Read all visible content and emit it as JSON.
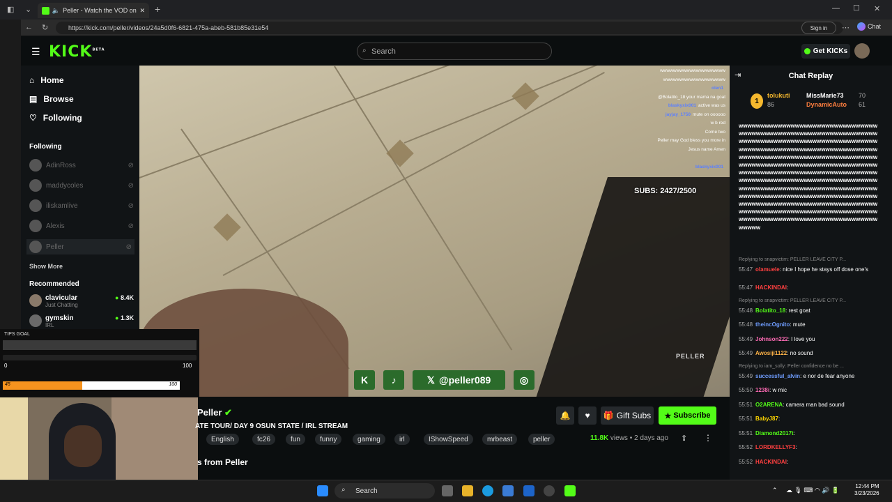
{
  "browser": {
    "tab_title": "Peller - Watch the VOD on Ki",
    "url": "https://kick.com/peller/videos/24a5d0f6-6821-475a-abeb-581b85e31e54",
    "signin": "Sign in",
    "chat_label": "Chat"
  },
  "header": {
    "logo": "KICK",
    "logo_sup": "BETA",
    "search_placeholder": "Search",
    "get_kicks": "Get KICKs"
  },
  "sidebar": {
    "nav": [
      {
        "label": "Home"
      },
      {
        "label": "Browse"
      },
      {
        "label": "Following"
      }
    ],
    "following_title": "Following",
    "following": [
      "AdinRoss",
      "maddycoles",
      "iliskamlive",
      "Alexis",
      "Peller"
    ],
    "show_more": "Show More",
    "recommended_title": "Recommended",
    "recommended": [
      {
        "name": "clavicular",
        "category": "Just Chatting",
        "viewers": "8.4K"
      },
      {
        "name": "gymskin",
        "category": "IRL",
        "viewers": "1.3K"
      }
    ]
  },
  "video": {
    "subs": "SUBS: 2427/2500",
    "watermark": "PELLER",
    "overlay_chat": [
      {
        "name": "",
        "text": "wwwwwwwwwwwwwwwwwwww"
      },
      {
        "name": "",
        "text": "wwwwwwwwwwwwwwwwwww"
      },
      {
        "name": "olen1",
        "text": ""
      },
      {
        "name": "",
        "text": "@Bolatito_18 your mama na goat"
      },
      {
        "name": "blaskyxix001",
        "text": "active was us"
      },
      {
        "name": "jayjay_1750",
        "text": "mute on oooooo"
      },
      {
        "name": "",
        "text": "w b red"
      },
      {
        "name": "",
        "text": "Come two"
      },
      {
        "name": "",
        "text": "Peller may God bless you more in"
      },
      {
        "name": "",
        "text": "Jesus name Amen"
      },
      {
        "name": "",
        "text": ""
      },
      {
        "name": "blaskyxix001",
        "text": ""
      }
    ],
    "social_handle": "@peller089"
  },
  "tips": {
    "label": "TIPS GOAL",
    "min": "0",
    "max": "100",
    "bar2_left": "45",
    "bar2_right": "100",
    "progress": 0.45
  },
  "channel": {
    "name": "Peller",
    "title": "ATE TOUR/ DAY 9 OSUN STATE / IRL STREAM",
    "tags": [
      "English",
      "fc26",
      "fun",
      "funny",
      "gaming",
      "irl",
      "IShowSpeed",
      "mrbeast",
      "peller"
    ],
    "views": "11.8K",
    "views_label": "views",
    "age": "2 days ago",
    "gift_subs": "Gift Subs",
    "subscribe": "Subscribe",
    "videos_heading": "s from Peller"
  },
  "chat": {
    "title": "Chat Replay",
    "gifters": [
      {
        "name": "tolukuti",
        "count": "86"
      },
      {
        "name": "MissMarie73",
        "count": "70"
      },
      {
        "name": "DynamicAuto",
        "count": "61"
      }
    ],
    "spam": "wwwwwwwwwwwwwwwwwwwwwwwwwwwwwwwwwwwwwwwwwwwwwwwwwwwwwwwwwwwwwwwwwwwwwwwwwwwwwwwwwwwwwwwwwwwwwwwwwwwwwwwwwwwwwwwwwwwwwwwwwwwwwwwwwwwwwwwwwwwwwwwwwwwwwwwwwwwwwwwwwwwwwwwwwwwwwwwwwwwwwwwwwwwwwwwwwwwwwwwwwwwwwwwwwwwwwwwwwwwwwwwwwwwwwwwwwwwwwwwwwwwwwwwwwwwwwwwwwwwwwwwwwwwwwwwwwwwwwwwwwwwwwwwwwwwwwwwwwwwwwwwwwwwwwwwwwwwwwwwwwwwwwwwwwwwwwwwwwwwwwwwwwwwwwwwwwwwwwwwwwwwwwwwwwwwwwwwwwwwwwwwwwwwwwwwwwwwwwwwwwwwwwwwwwwwwwwwwwwwww",
    "messages": [
      {
        "reply": "Replying to snapvictim: PELLER LEAVE CITY P...",
        "time": "",
        "user": "",
        "color": "",
        "text": ""
      },
      {
        "reply": "",
        "time": "55:47",
        "user": "olamuele",
        "color": "#ff4040",
        "text": "nice I hope he stays off dose one's"
      },
      {
        "reply": "",
        "time": "55:47",
        "user": "HACKINDAI",
        "color": "#ff4040",
        "text": ""
      },
      {
        "reply": "Replying to snapvictim: PELLER LEAVE CITY P...",
        "time": "",
        "user": "",
        "color": "",
        "text": ""
      },
      {
        "reply": "",
        "time": "55:48",
        "user": "Bolatito_18",
        "color": "#53fc18",
        "text": "rest goat"
      },
      {
        "reply": "",
        "time": "55:48",
        "user": "theincOgnito",
        "color": "#6f9dff",
        "text": "mute"
      },
      {
        "reply": "",
        "time": "55:49",
        "user": "Johnson222",
        "color": "#ff6bb5",
        "text": "I love you"
      },
      {
        "reply": "",
        "time": "55:49",
        "user": "Awosiji1122",
        "color": "#ffb347",
        "text": "no sound"
      },
      {
        "reply": "Replying to iam_solly: Peller confidence no be ...",
        "time": "",
        "user": "",
        "color": "",
        "text": ""
      },
      {
        "reply": "",
        "time": "55:49",
        "user": "successful_alvin",
        "color": "#6f9dff",
        "text": "e nor de fear anyone"
      },
      {
        "reply": "",
        "time": "55:50",
        "user": "1238i",
        "color": "#ff6bb5",
        "text": "w mic"
      },
      {
        "reply": "",
        "time": "55:51",
        "user": "O2ARENA",
        "color": "#53fc18",
        "text": "camera man bad sound"
      },
      {
        "reply": "",
        "time": "55:51",
        "user": "BabyJ87",
        "color": "#ffd700",
        "text": ""
      },
      {
        "reply": "",
        "time": "55:51",
        "user": "Diamond2017t",
        "color": "#53fc18",
        "text": ""
      },
      {
        "reply": "",
        "time": "55:52",
        "user": "LORDKELLYF3",
        "color": "#ff4040",
        "text": ""
      },
      {
        "reply": "",
        "time": "55:52",
        "user": "HACKINDAI",
        "color": "#ff4040",
        "text": ""
      }
    ]
  },
  "taskbar": {
    "search": "Search",
    "time": "12:44 PM",
    "date": "3/23/2026"
  },
  "colors": {
    "accent": "#53fc18",
    "bg": "#0b0e0f",
    "panel": "#111416"
  }
}
